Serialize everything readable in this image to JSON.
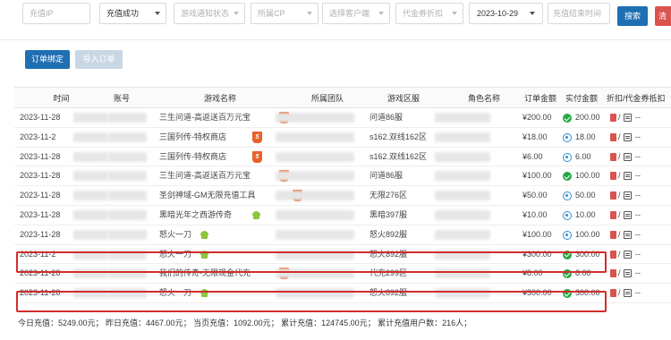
{
  "filters": {
    "recharge_ip_placeholder": "充值IP",
    "status_selected": "充值成功",
    "notify_placeholder": "游戏通知状态",
    "cp_placeholder": "所属CP",
    "customer_placeholder": "选择客户端",
    "voucher_placeholder": "代金券折扣",
    "start_date": "2023-10-29",
    "end_date_placeholder": "充值结束时间",
    "search_label": "搜索",
    "extra_label": "清"
  },
  "actions": {
    "bind_label": "订单绑定",
    "import_label": "导入订单"
  },
  "table": {
    "headers": [
      "时间",
      "账号",
      "游戏名称",
      "所属团队",
      "游戏区服",
      "角色名称",
      "订单金额",
      "实付金额",
      "折扣/代金券抵扣"
    ],
    "rows": [
      {
        "time": "2023-11-28",
        "game": "三生问道-高返送百万元宝",
        "platform": "h5",
        "server": "问道86服",
        "amount": "¥200.00",
        "paid": "200.00",
        "pay": "green",
        "discount": "--"
      },
      {
        "time": "2023-11-2",
        "game": "三国列传-特权商店",
        "platform": "h5",
        "server": "s162.双线162区",
        "amount": "¥18.00",
        "paid": "18.00",
        "pay": "blue",
        "discount": "--"
      },
      {
        "time": "2023-11-28",
        "game": "三国列传-特权商店",
        "platform": "h5",
        "server": "s162.双线162区",
        "amount": "¥6.00",
        "paid": "6.00",
        "pay": "blue",
        "discount": "--"
      },
      {
        "time": "2023-11-28",
        "game": "三生问道-高返送百万元宝",
        "platform": "h5",
        "server": "问道86服",
        "amount": "¥100.00",
        "paid": "100.00",
        "pay": "green",
        "discount": "--"
      },
      {
        "time": "2023-11-28",
        "game": "圣剑神域-GM无限充值工具",
        "platform": "h5",
        "server": "无限276区",
        "amount": "¥50.00",
        "paid": "50.00",
        "pay": "blue",
        "discount": "--"
      },
      {
        "time": "2023-11-28",
        "game": "黑暗光年之西游传奇",
        "platform": "android",
        "server": "黑暗397服",
        "amount": "¥10.00",
        "paid": "10.00",
        "pay": "blue",
        "discount": "--"
      },
      {
        "time": "2023-11-28",
        "game": "怒火一刀",
        "platform": "android",
        "server": "怒火892服",
        "amount": "¥100.00",
        "paid": "100.00",
        "pay": "blue",
        "discount": "--"
      },
      {
        "time": "2023-11-2",
        "game": "怒火一刀",
        "platform": "android",
        "server": "怒火892服",
        "amount": "¥300.00",
        "paid": "300.00",
        "pay": "green",
        "discount": "--"
      },
      {
        "time": "2023-11-28",
        "game": "我们的传奇-无限现金代充",
        "platform": "h5",
        "server": "代充299区",
        "amount": "¥8.00",
        "paid": "8.00",
        "pay": "green",
        "discount": "--"
      },
      {
        "time": "2023-11-28",
        "game": "怒火一刀",
        "platform": "android",
        "server": "怒火892服",
        "amount": "¥300.00",
        "paid": "300.00",
        "pay": "green",
        "discount": "--"
      }
    ]
  },
  "footer": {
    "summary": "今日充值：5249.00元；  昨日充值：4467.00元；  当页充值：1092.00元；  累计充值：124745.00元；  累计充值用户数：216人；"
  },
  "colors": {
    "primary": "#1f6fb2",
    "highlight_border": "#d22d2d",
    "paid_green": "#27a844",
    "paid_blue": "#2e8fd6"
  },
  "icons": {
    "h5": "html5-icon",
    "android": "android-icon",
    "voucher": "voucher-icon",
    "edit": "edit-icon"
  }
}
